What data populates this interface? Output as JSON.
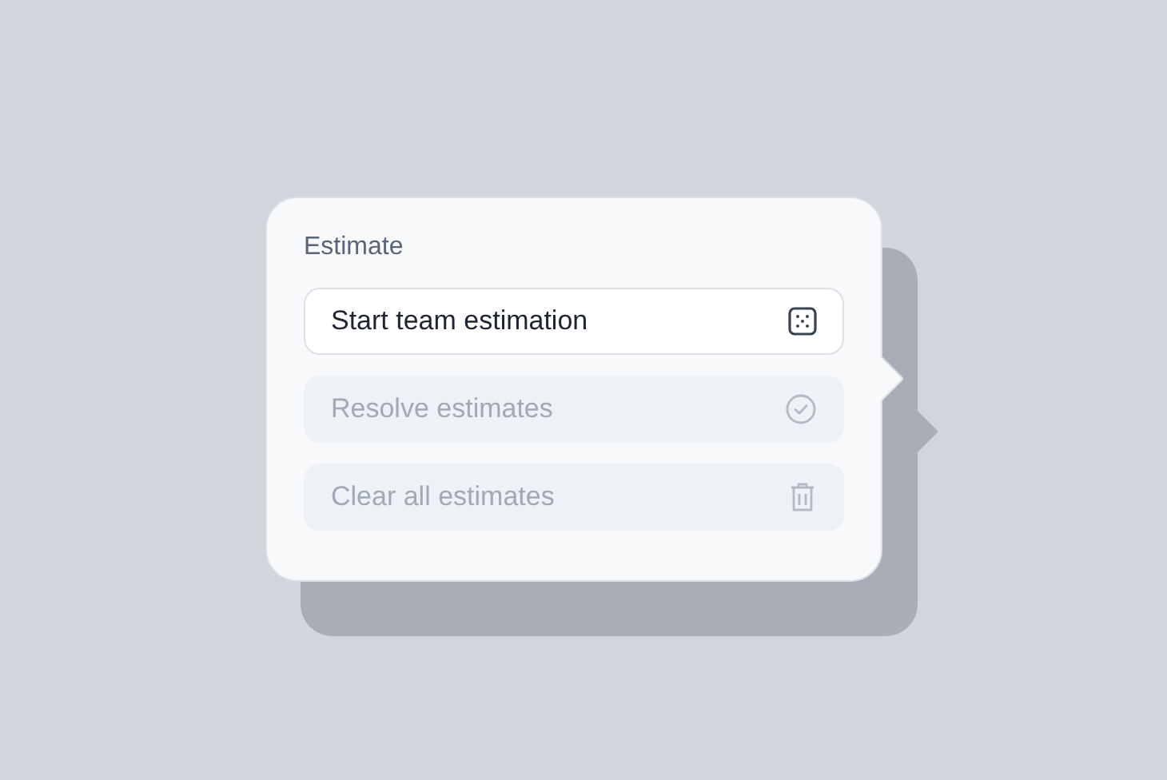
{
  "popover": {
    "title": "Estimate",
    "items": [
      {
        "label": "Start team estimation",
        "kind": "dice",
        "disabled": false
      },
      {
        "label": "Resolve estimates",
        "kind": "check",
        "disabled": true
      },
      {
        "label": "Clear all estimates",
        "kind": "trash",
        "disabled": true
      }
    ]
  }
}
